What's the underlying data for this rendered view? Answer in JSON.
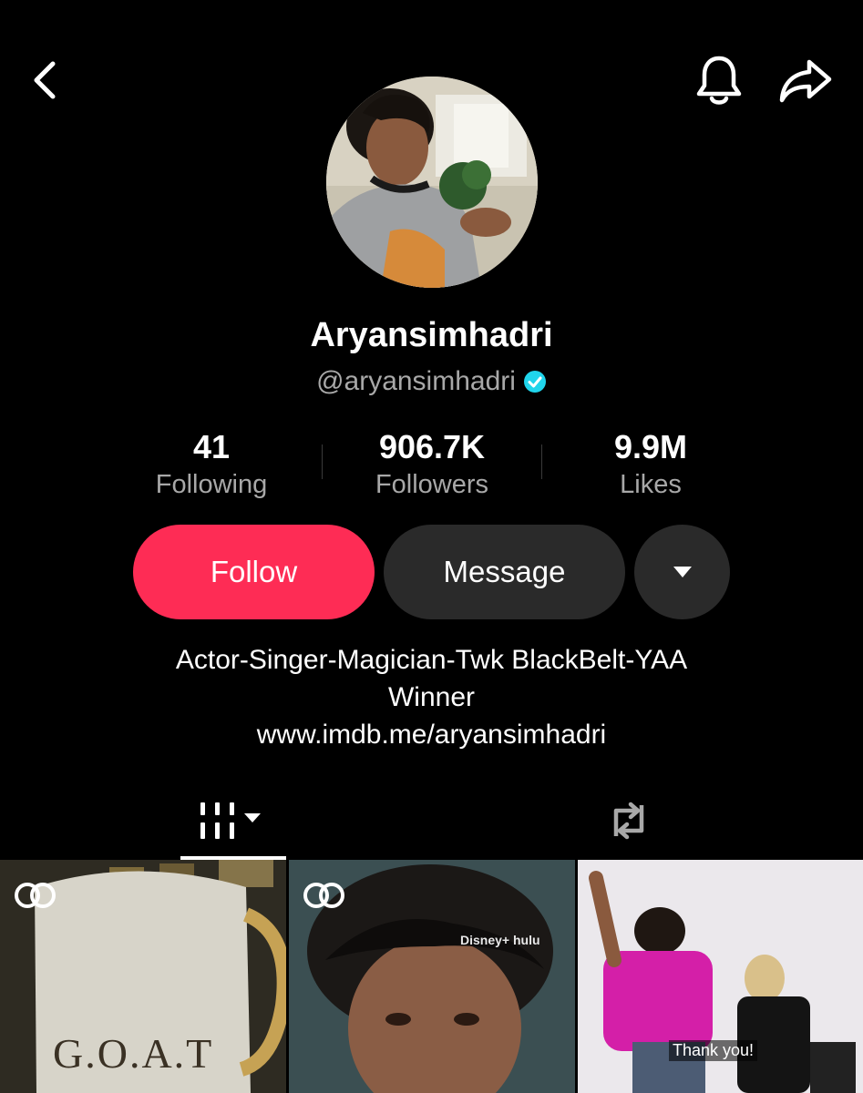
{
  "header": {
    "back_icon": "chevron-left-icon",
    "bell_icon": "bell-icon",
    "share_icon": "share-arrow-icon"
  },
  "profile": {
    "display_name": "Aryansimhadri",
    "handle": "@aryansimhadri",
    "verified": true
  },
  "stats": {
    "following": {
      "value": "41",
      "label": "Following"
    },
    "followers": {
      "value": "906.7K",
      "label": "Followers"
    },
    "likes": {
      "value": "9.9M",
      "label": "Likes"
    }
  },
  "actions": {
    "follow_label": "Follow",
    "message_label": "Message",
    "more_icon": "caret-down-icon"
  },
  "bio": {
    "line1": "Actor-Singer-Magician-Twk BlackBelt-YAA",
    "line2": "Winner",
    "link": "www.imdb.me/aryansimhadri"
  },
  "tabs": [
    {
      "name": "videos",
      "icon": "grid-icon",
      "active": true
    },
    {
      "name": "reposts",
      "icon": "repost-icon",
      "active": false
    }
  ],
  "grid": {
    "tiles": [
      {
        "caption": "G.O.A.T",
        "badge_icon": "collab-icon"
      },
      {
        "caption": "Disney+ hulu",
        "badge_icon": "collab-icon"
      },
      {
        "caption": "Thank you!"
      }
    ]
  },
  "colors": {
    "background": "#000000",
    "follow_button": "#fe2c55",
    "secondary_button": "#2a2a2a",
    "muted_text": "#a8a8a8",
    "verified": "#20d5ec"
  }
}
